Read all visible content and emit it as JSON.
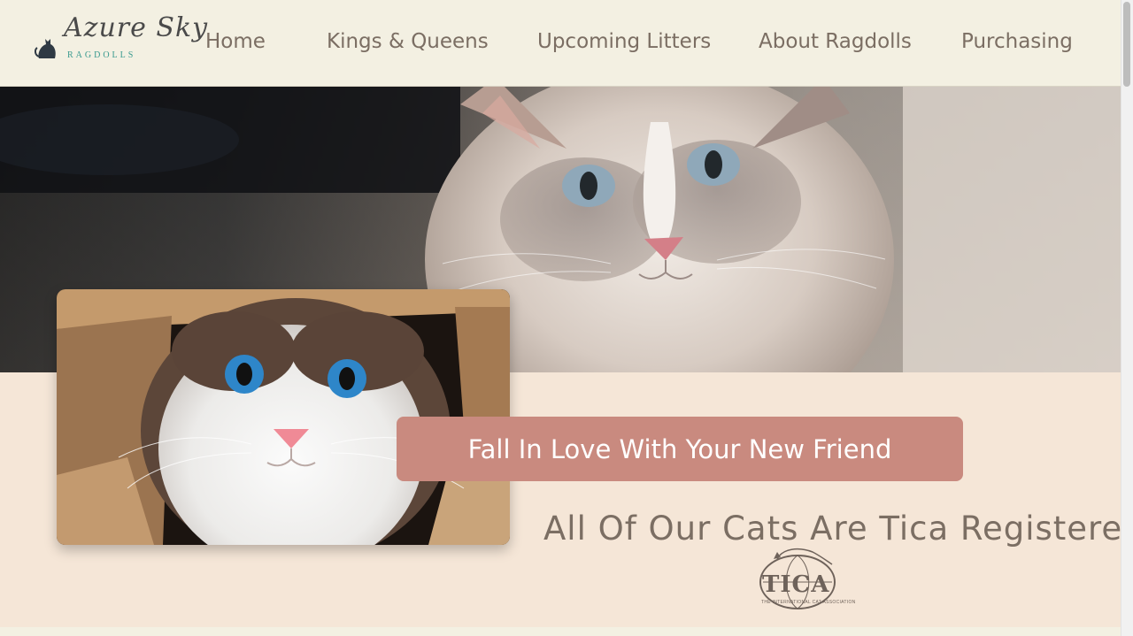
{
  "brand": {
    "script_name": "Azure Sky",
    "subtitle": "RAGDOLLS"
  },
  "nav": {
    "items": [
      {
        "label": "Home"
      },
      {
        "label": "Kings & Queens"
      },
      {
        "label": "Upcoming Litters"
      },
      {
        "label": "About Ragdolls"
      },
      {
        "label": "Purchasing"
      }
    ]
  },
  "cta": {
    "label": "Fall In Love With Your New Friend"
  },
  "registration": {
    "text": "All Of Our Cats Are Tica Registered",
    "logo_text": "TICA",
    "logo_subtext": "THE INTERNATIONAL CAT ASSOCIATION"
  },
  "colors": {
    "header_bg": "#f3f0e2",
    "page_bg": "#f5e6d7",
    "cta_bg": "#c98a7f",
    "text": "#7b6e63",
    "brand_accent": "#3a9a8f"
  },
  "icons": {
    "logo_cat": "cat-silhouette-icon",
    "tica": "tica-globe-cat-icon"
  }
}
